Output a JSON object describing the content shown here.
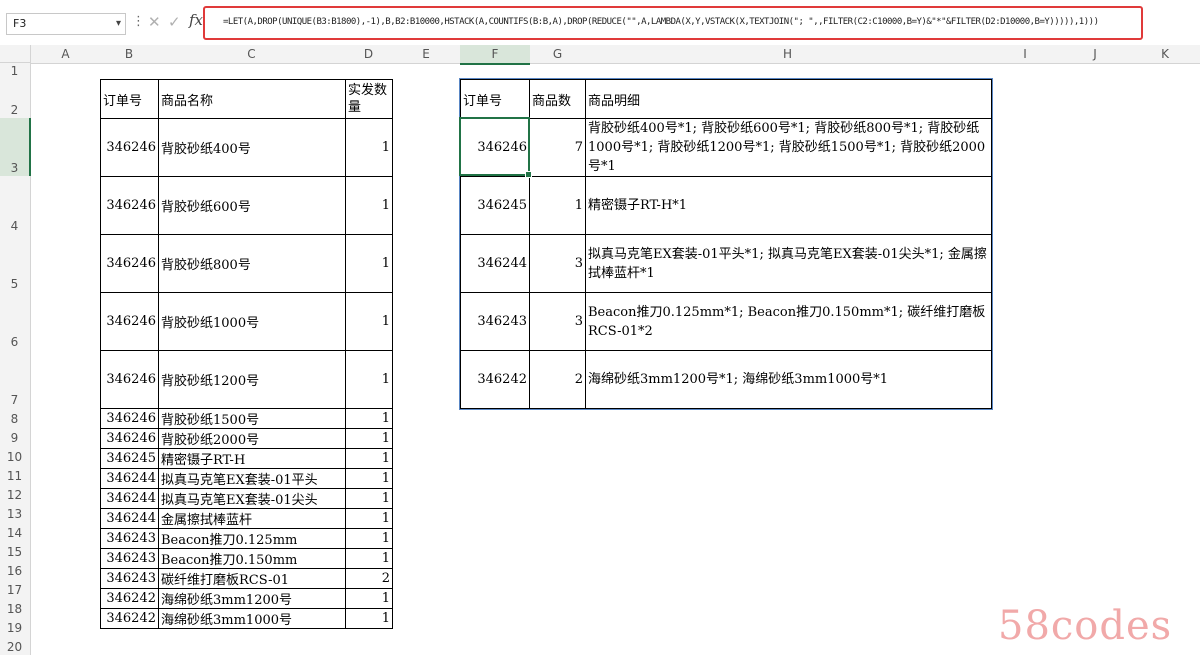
{
  "formula_bar": {
    "name_box": "F3",
    "formula": "=LET(A,DROP(UNIQUE(B3:B1800),-1),B,B2:B10000,HSTACK(A,COUNTIFS(B:B,A),DROP(REDUCE(\"\",A,LAMBDA(X,Y,VSTACK(X,TEXTJOIN(\"; \",,FILTER(C2:C10000,B=Y)&\"*\"&FILTER(D2:D10000,B=Y))))),1)))"
  },
  "columns": [
    "A",
    "B",
    "C",
    "D",
    "E",
    "F",
    "G",
    "H",
    "I",
    "J",
    "K"
  ],
  "rows": [
    "1",
    "2",
    "3",
    "4",
    "5",
    "6",
    "7",
    "8",
    "9",
    "10",
    "11",
    "12",
    "13",
    "14",
    "15",
    "16",
    "17",
    "18",
    "19",
    "20"
  ],
  "left_table": {
    "headers": [
      "订单号",
      "商品名称",
      "实发数量"
    ],
    "rows": [
      {
        "order": "346246",
        "name": "背胶砂纸400号",
        "qty": "1"
      },
      {
        "order": "346246",
        "name": "背胶砂纸600号",
        "qty": "1"
      },
      {
        "order": "346246",
        "name": "背胶砂纸800号",
        "qty": "1"
      },
      {
        "order": "346246",
        "name": "背胶砂纸1000号",
        "qty": "1"
      },
      {
        "order": "346246",
        "name": "背胶砂纸1200号",
        "qty": "1"
      },
      {
        "order": "346246",
        "name": "背胶砂纸1500号",
        "qty": "1"
      },
      {
        "order": "346246",
        "name": "背胶砂纸2000号",
        "qty": "1"
      },
      {
        "order": "346245",
        "name": "精密镊子RT-H",
        "qty": "1"
      },
      {
        "order": "346244",
        "name": "拟真马克笔EX套装-01平头",
        "qty": "1"
      },
      {
        "order": "346244",
        "name": "拟真马克笔EX套装-01尖头",
        "qty": "1"
      },
      {
        "order": "346244",
        "name": "金属擦拭棒蓝杆",
        "qty": "1"
      },
      {
        "order": "346243",
        "name": "Beacon推刀0.125mm",
        "qty": "1"
      },
      {
        "order": "346243",
        "name": "Beacon推刀0.150mm",
        "qty": "1"
      },
      {
        "order": "346243",
        "name": "碳纤维打磨板RCS-01",
        "qty": "2"
      },
      {
        "order": "346242",
        "name": "海绵砂纸3mm1200号",
        "qty": "1"
      },
      {
        "order": "346242",
        "name": "海绵砂纸3mm1000号",
        "qty": "1"
      }
    ]
  },
  "right_table": {
    "headers": [
      "订单号",
      "商品数",
      "商品明细"
    ],
    "rows": [
      {
        "order": "346246",
        "count": "7",
        "detail": "背胶砂纸400号*1; 背胶砂纸600号*1; 背胶砂纸800号*1; 背胶砂纸1000号*1; 背胶砂纸1200号*1; 背胶砂纸1500号*1; 背胶砂纸2000号*1"
      },
      {
        "order": "346245",
        "count": "1",
        "detail": "精密镊子RT-H*1"
      },
      {
        "order": "346244",
        "count": "3",
        "detail": "拟真马克笔EX套装-01平头*1; 拟真马克笔EX套装-01尖头*1; 金属擦拭棒蓝杆*1"
      },
      {
        "order": "346243",
        "count": "3",
        "detail": "Beacon推刀0.125mm*1; Beacon推刀0.150mm*1; 碳纤维打磨板RCS-01*2"
      },
      {
        "order": "346242",
        "count": "2",
        "detail": "海绵砂纸3mm1200号*1; 海绵砂纸3mm1000号*1"
      }
    ]
  },
  "watermark": "58codes"
}
